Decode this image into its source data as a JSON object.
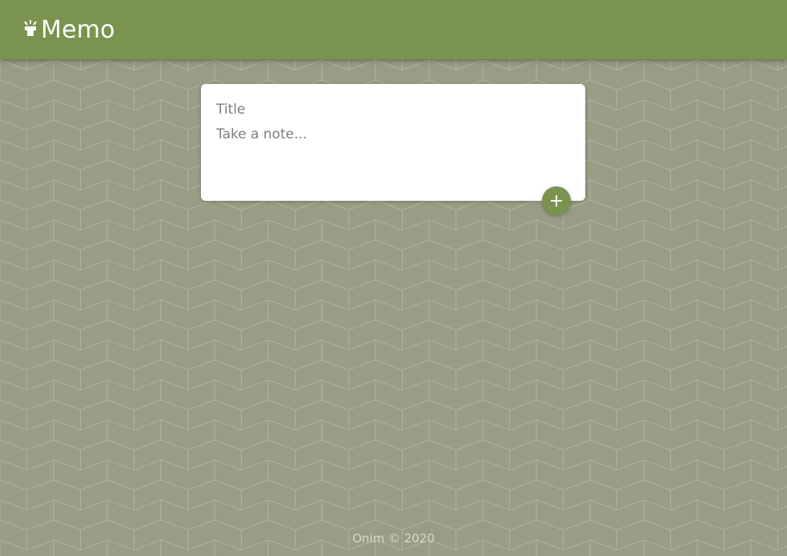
{
  "header": {
    "title": "Memo",
    "logo_icon": "lightbulb-icon"
  },
  "note_form": {
    "title_placeholder": "Title",
    "content_placeholder": "Take a note...",
    "title_value": "",
    "content_value": "",
    "add_icon": "plus-icon"
  },
  "footer": {
    "text": "Onim © 2020"
  },
  "colors": {
    "header_bg": "#7a944f",
    "page_bg": "#9a9c86",
    "button_bg": "#7a944f",
    "card_bg": "#ffffff"
  }
}
